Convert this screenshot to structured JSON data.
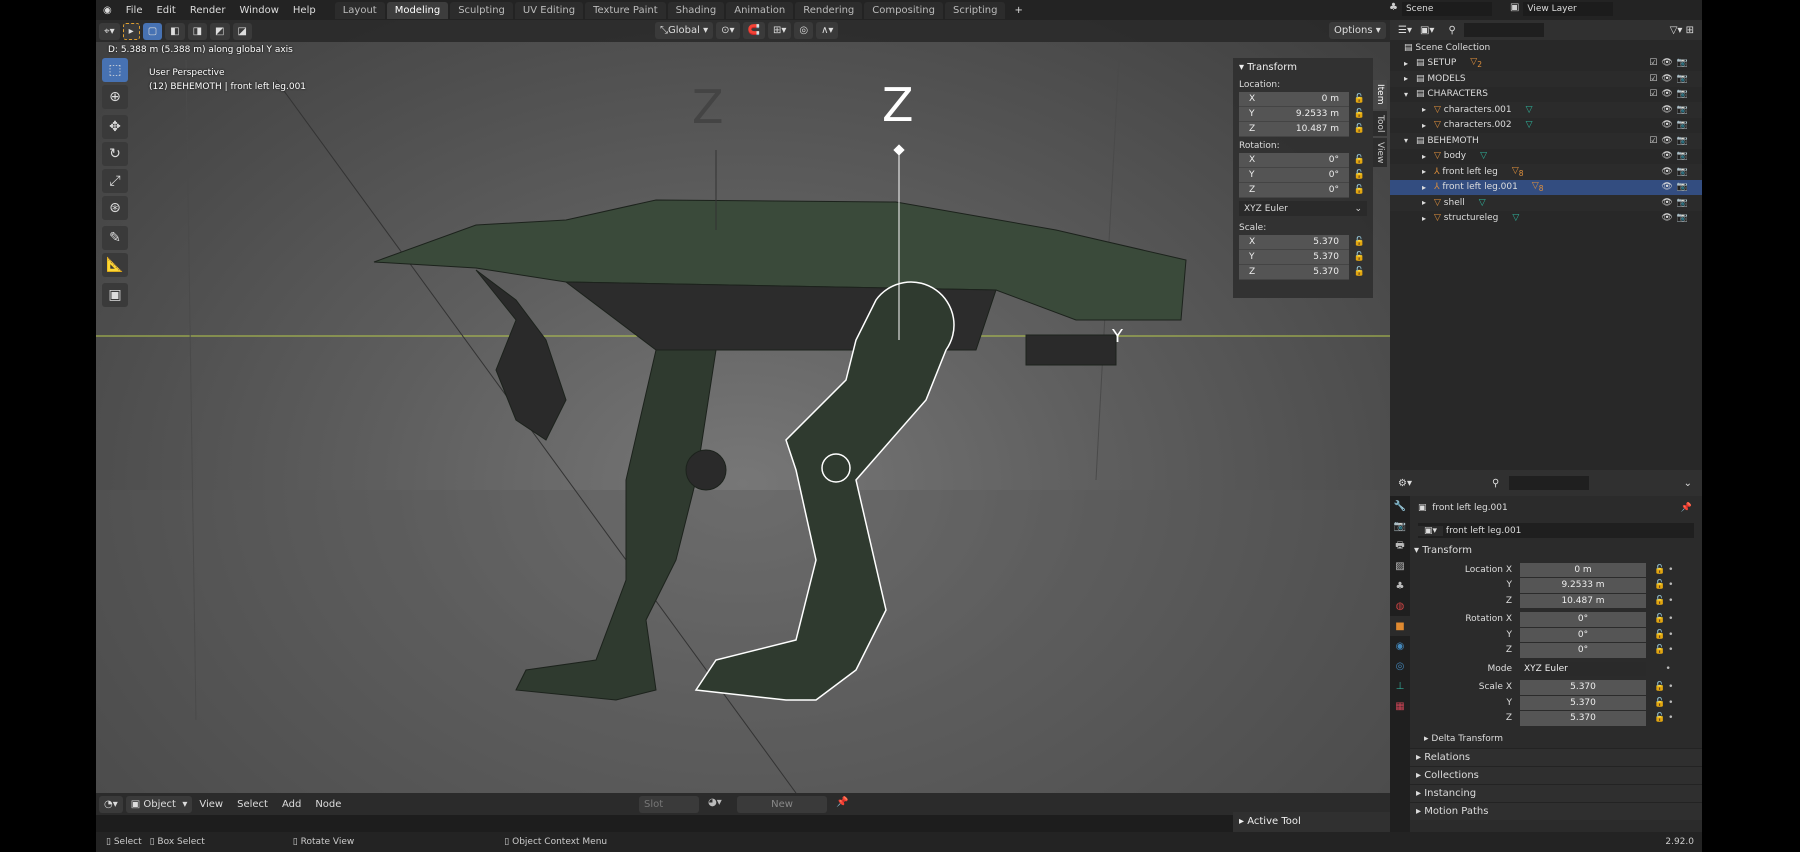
{
  "topbar": {
    "menus": [
      "File",
      "Edit",
      "Render",
      "Window",
      "Help"
    ],
    "workspaces": [
      "Layout",
      "Modeling",
      "Sculpting",
      "UV Editing",
      "Texture Paint",
      "Shading",
      "Animation",
      "Rendering",
      "Compositing",
      "Scripting"
    ],
    "active_workspace": "Modeling",
    "add": "+",
    "scene": "Scene",
    "view_layer": "View Layer"
  },
  "viewport": {
    "transform_orientation": "Global",
    "options": "Options",
    "status": "D: 5.388 m (5.388 m) along global Y axis",
    "perspective": "User Perspective",
    "object_info": "(12) BEHEMOTH | front left leg.001",
    "axis_labels": [
      "Z",
      "Z",
      "Y"
    ]
  },
  "npanel": {
    "title": "Transform",
    "location_label": "Location:",
    "location": [
      {
        "axis": "X",
        "value": "0 m"
      },
      {
        "axis": "Y",
        "value": "9.2533 m"
      },
      {
        "axis": "Z",
        "value": "10.487 m"
      }
    ],
    "rotation_label": "Rotation:",
    "rotation": [
      {
        "axis": "X",
        "value": "0°"
      },
      {
        "axis": "Y",
        "value": "0°"
      },
      {
        "axis": "Z",
        "value": "0°"
      }
    ],
    "rotation_mode": "XYZ Euler",
    "scale_label": "Scale:",
    "scale": [
      {
        "axis": "X",
        "value": "5.370"
      },
      {
        "axis": "Y",
        "value": "5.370"
      },
      {
        "axis": "Z",
        "value": "5.370"
      }
    ],
    "tabs": [
      "Item",
      "Tool",
      "View"
    ]
  },
  "outliner": {
    "root": "Scene Collection",
    "rows": [
      {
        "name": "SETUP",
        "type": "collection",
        "depth": 0,
        "badge": "2"
      },
      {
        "name": "MODELS",
        "type": "collection",
        "depth": 0
      },
      {
        "name": "CHARACTERS",
        "type": "collection",
        "depth": 0
      },
      {
        "name": "characters.001",
        "type": "mesh",
        "depth": 1
      },
      {
        "name": "characters.002",
        "type": "mesh",
        "depth": 1
      },
      {
        "name": "BEHEMOTH",
        "type": "collection",
        "depth": 0
      },
      {
        "name": "body",
        "type": "mesh",
        "depth": 1
      },
      {
        "name": "front left leg",
        "type": "armature",
        "depth": 1,
        "badge": "8"
      },
      {
        "name": "front left leg.001",
        "type": "armature",
        "depth": 1,
        "badge": "8",
        "selected": true
      },
      {
        "name": "shell",
        "type": "mesh",
        "depth": 1
      },
      {
        "name": "structureleg",
        "type": "mesh",
        "depth": 1
      }
    ]
  },
  "properties": {
    "object_name": "front left leg.001",
    "data_name": "front left leg.001",
    "section": "Transform",
    "location_x_label": "Location X",
    "location": [
      "0 m",
      "9.2533 m",
      "10.487 m"
    ],
    "rotation_x_label": "Rotation X",
    "rotation": [
      "0°",
      "0°",
      "0°"
    ],
    "mode_label": "Mode",
    "mode": "XYZ Euler",
    "scale_x_label": "Scale X",
    "scale": [
      "5.370",
      "5.370",
      "5.370"
    ],
    "y_label": "Y",
    "z_label": "Z",
    "delta": "Delta Transform",
    "sections": [
      "Relations",
      "Collections",
      "Instancing",
      "Motion Paths"
    ]
  },
  "node_editor": {
    "mode": "Object",
    "menus": [
      "View",
      "Select",
      "Add",
      "Node"
    ],
    "slot": "Slot",
    "new": "New"
  },
  "active_tool": "Active Tool",
  "status": {
    "select": "Select",
    "box_select": "Box Select",
    "rotate": "Rotate View",
    "context": "Object Context Menu",
    "version": "2.92.0"
  }
}
